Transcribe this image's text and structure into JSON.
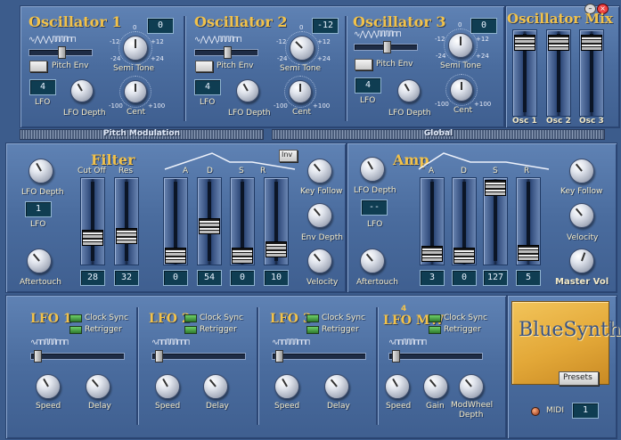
{
  "osc1": {
    "title": "Oscillator 1",
    "semi_value": "0",
    "semi_label": "Semi Tone",
    "semi_min": "-24",
    "semi_neg": "-12",
    "semi_zero": "0",
    "semi_pos": "+12",
    "semi_max": "+24",
    "pitch_env": "Pitch Env",
    "lfo_label": "LFO",
    "lfo_value": "4",
    "lfo_depth": "LFO Depth",
    "cent_label": "Cent",
    "cent_min": "-100",
    "cent_max": "+100",
    "wave": "∿⋀⋀⋀ЛЛЛЛ⊓⊓"
  },
  "osc2": {
    "title": "Oscillator 2",
    "semi_value": "-12",
    "semi_label": "Semi Tone",
    "semi_min": "-24",
    "semi_neg": "-12",
    "semi_zero": "0",
    "semi_pos": "+12",
    "semi_max": "+24",
    "pitch_env": "Pitch Env",
    "lfo_label": "LFO",
    "lfo_value": "4",
    "lfo_depth": "LFO Depth",
    "cent_label": "Cent",
    "cent_min": "-100",
    "cent_max": "+100",
    "wave": "∿⋀⋀⋀ЛЛЛЛ⊓⊓"
  },
  "osc3": {
    "title": "Oscillator 3",
    "semi_value": "0",
    "semi_label": "Semi Tone",
    "semi_min": "-24",
    "semi_neg": "-12",
    "semi_zero": "0",
    "semi_pos": "+12",
    "semi_max": "+24",
    "pitch_env": "Pitch Env",
    "lfo_label": "LFO",
    "lfo_value": "4",
    "lfo_depth": "LFO Depth",
    "cent_label": "Cent",
    "cent_min": "-100",
    "cent_max": "+100",
    "wave": "∿⋀⋀⋀ЛЛЛЛ⊓⊓"
  },
  "mix": {
    "title": "Oscillator Mix",
    "osc1": "Osc 1",
    "osc2": "Osc 2",
    "osc3": "Osc 3"
  },
  "bars": {
    "pitch_mod": "Pitch Modulation",
    "global": "Global"
  },
  "filter": {
    "title": "Filter",
    "lfo_depth": "LFO Depth",
    "lfo_label": "LFO",
    "lfo_value": "1",
    "aftertouch": "Aftertouch",
    "cutoff": "Cut Off",
    "res": "Res",
    "cutoff_value": "28",
    "res_value": "32",
    "inv": "Inv",
    "a": "A",
    "d": "D",
    "s": "S",
    "r": "R",
    "a_value": "0",
    "d_value": "54",
    "s_value": "0",
    "r_value": "10",
    "key_follow": "Key Follow",
    "env_depth": "Env Depth",
    "velocity": "Velocity"
  },
  "amp": {
    "title": "Amp",
    "lfo_depth": "LFO Depth",
    "lfo_label": "LFO",
    "lfo_value": "--",
    "aftertouch": "Aftertouch",
    "a": "A",
    "d": "D",
    "s": "S",
    "r": "R",
    "a_value": "3",
    "d_value": "0",
    "s_value": "127",
    "r_value": "5",
    "key_follow": "Key Follow",
    "velocity": "Velocity",
    "master_vol": "Master Vol"
  },
  "lfo1": {
    "title": "LFO 1",
    "clock_sync": "Clock Sync",
    "retrigger": "Retrigger",
    "speed": "Speed",
    "delay": "Delay",
    "wave": "∿⊓⊓ЛЛЛ⊓⊓⊓"
  },
  "lfo2": {
    "title": "LFO 2",
    "clock_sync": "Clock Sync",
    "retrigger": "Retrigger",
    "speed": "Speed",
    "delay": "Delay",
    "wave": "∿⊓⊓ЛЛЛ⊓⊓⊓"
  },
  "lfo3": {
    "title": "LFO 3",
    "clock_sync": "Clock Sync",
    "retrigger": "Retrigger",
    "speed": "Speed",
    "delay": "Delay",
    "wave": "∿⊓⊓ЛЛЛ⊓⊓⊓"
  },
  "lfo4": {
    "title": "LFO MW",
    "sup": "4",
    "clock_sync": "Clock Sync",
    "retrigger": "Retrigger",
    "speed": "Speed",
    "gain": "Gain",
    "modwheel": "ModWheel",
    "depth": "Depth",
    "wave": "∿⊓⊓ЛЛЛ⊓⊓⊓"
  },
  "brand": {
    "name": "BlueSynth",
    "presets": "Presets",
    "midi": "MIDI",
    "midi_channel": "1"
  },
  "window": {
    "close_icon": "close-icon",
    "minimize_icon": "minimize-icon"
  }
}
